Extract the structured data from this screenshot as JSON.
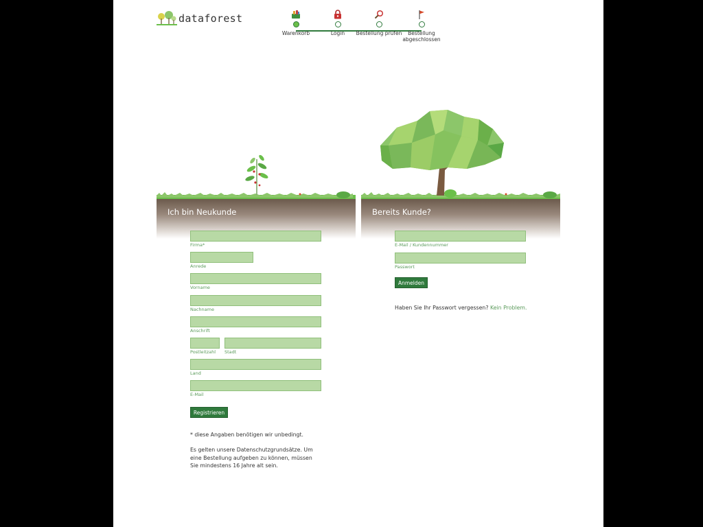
{
  "header": {
    "logo_text": "dataforest",
    "steps": [
      {
        "label": "Warenkorb",
        "icon": "basket-icon",
        "active": true
      },
      {
        "label": "Login",
        "icon": "lock-icon",
        "active": false
      },
      {
        "label": "Bestellung prüfen",
        "icon": "magnifier-icon",
        "active": false
      },
      {
        "label": "Bestellung abgeschlossen",
        "icon": "flag-icon",
        "active": false
      }
    ]
  },
  "new_customer": {
    "title": "Ich bin Neukunde",
    "fields": {
      "firma": "Firma*",
      "anrede": "Anrede",
      "vorname": "Vorname",
      "nachname": "Nachname",
      "anschrift": "Anschrift",
      "postleitzahl": "Postleitzahl",
      "stadt": "Stadt",
      "land": "Land",
      "email": "E-Mail"
    },
    "register_button": "Registrieren",
    "required_note": "* diese Angaben benötigen wir unbedingt.",
    "privacy_note": "Es gelten unsere Datenschutzgrundsätze. Um eine Bestellung aufgeben zu können, müssen Sie mindestens 16 Jahre alt sein."
  },
  "existing_customer": {
    "title": "Bereits Kunde?",
    "fields": {
      "email": "E-Mail / Kundennummer",
      "password": "Passwort"
    },
    "login_button": "Anmelden",
    "forgot_text": "Haben Sie Ihr Passwort vergessen?",
    "forgot_link": "Kein Problem."
  },
  "colors": {
    "accent": "#2f7a3c",
    "input_bg": "#b8d9a5",
    "label": "#5a9a5a"
  }
}
